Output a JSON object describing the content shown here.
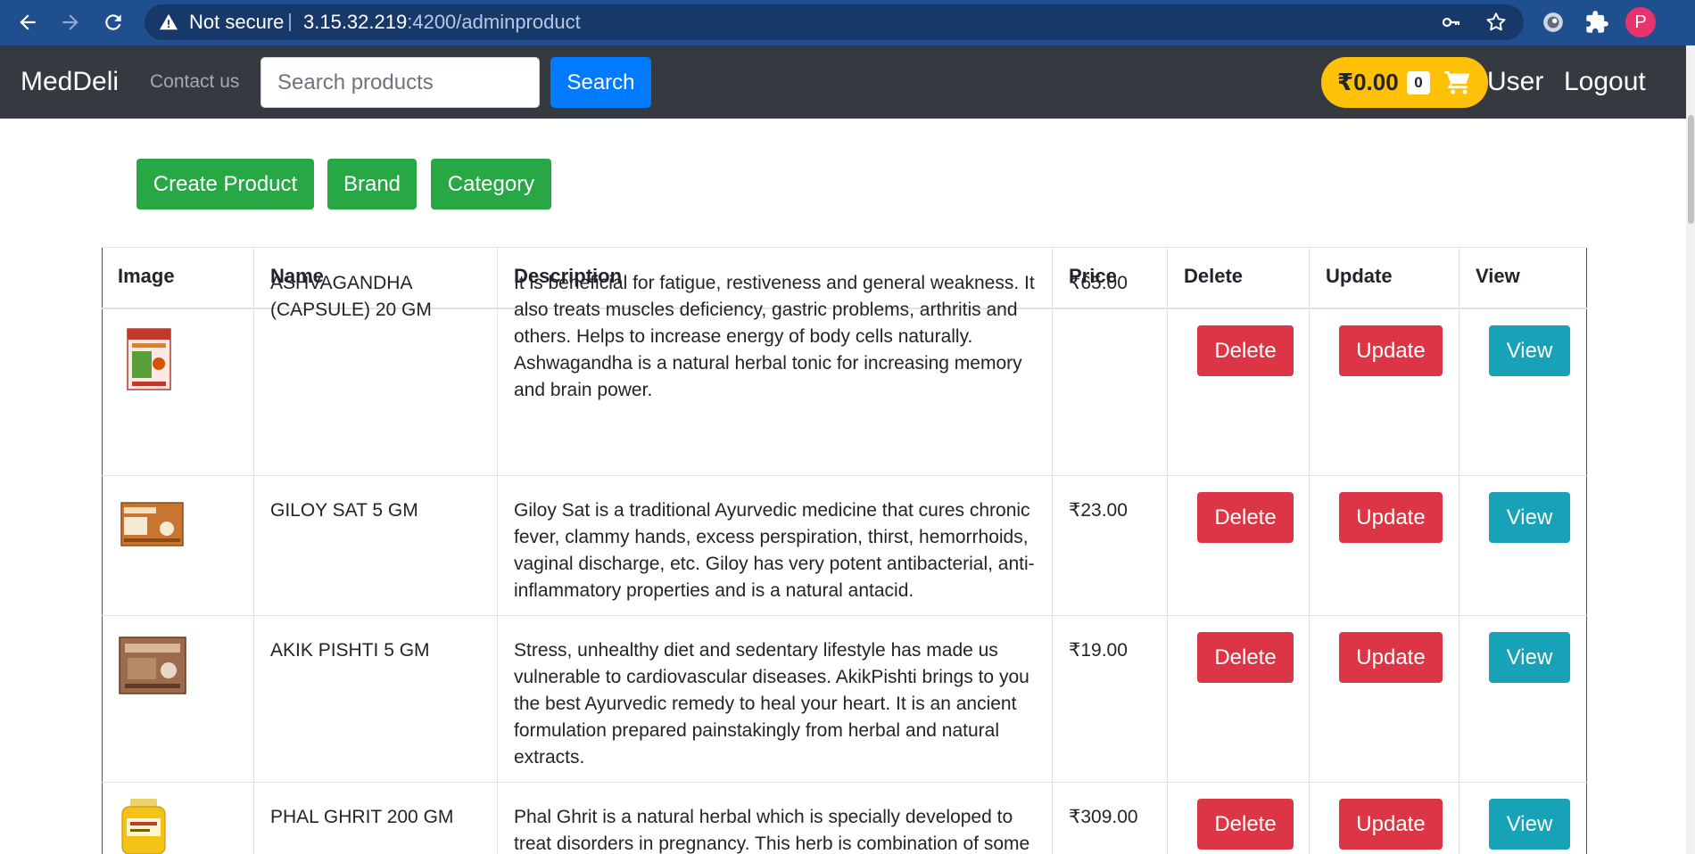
{
  "browser": {
    "security_label": "Not secure",
    "url_host": "3.15.32.219",
    "url_path": ":4200/adminproduct",
    "profile_initial": "P"
  },
  "navbar": {
    "brand": "MedDeli",
    "contact": "Contact us",
    "search_placeholder": "Search products",
    "search_button": "Search",
    "cart_total": "₹0.00",
    "cart_count": "0",
    "user": "User",
    "logout": "Logout"
  },
  "actions": {
    "create_product": "Create Product",
    "brand": "Brand",
    "category": "Category"
  },
  "table": {
    "headers": [
      "Image",
      "Name",
      "Description",
      "Price",
      "Delete",
      "Update",
      "View"
    ],
    "delete_label": "Delete",
    "update_label": "Update",
    "view_label": "View",
    "rows": [
      {
        "name_lines": [
          "ASHVAGANDHA",
          "(CAPSULE) 20 GM"
        ],
        "desc_lines": [
          "It is beneficial for fatigue, restiveness and general weakness. It",
          "also treats muscles deficiency, gastric problems, arthritis and",
          "others. Helps to increase energy of body cells naturally.",
          "Ashwagandha is a natural herbal tonic for increasing memory",
          "and brain power."
        ],
        "price": "₹65.00"
      },
      {
        "name_lines": [
          "GILOY SAT 5 GM"
        ],
        "desc_lines": [
          "Giloy Sat is a traditional Ayurvedic medicine that cures chronic",
          "fever, clammy hands, excess perspiration, thirst, hemorrhoids,",
          "vaginal discharge, etc. Giloy has very potent antibacterial, anti-",
          "inflammatory properties and is a natural antacid."
        ],
        "price": "₹23.00"
      },
      {
        "name_lines": [
          "AKIK PISHTI 5 GM"
        ],
        "desc_lines": [
          "Stress, unhealthy diet and sedentary lifestyle has made us",
          "vulnerable to cardiovascular diseases. AkikPishti brings to you",
          "the best Ayurvedic remedy to heal your heart. It is an ancient",
          "formulation prepared painstakingly from herbal and natural",
          "extracts."
        ],
        "price": "₹19.00"
      },
      {
        "name_lines": [
          "PHAL GHRIT 200 GM"
        ],
        "desc_lines": [
          "Phal Ghrit is a natural herbal which is specially developed to",
          "treat disorders in pregnancy. This herb is combination of some"
        ],
        "price": "₹309.00"
      }
    ]
  },
  "colors": {
    "chrome": "#1f4f8f",
    "navbar": "#343a40",
    "primary": "#007bff",
    "success": "#28a745",
    "danger": "#dc3545",
    "info": "#17a2b8",
    "cart": "#ffc107"
  },
  "icons": [
    "back-arrow-icon",
    "forward-arrow-icon",
    "reload-icon",
    "warning-icon",
    "key-icon",
    "star-icon",
    "extension-ring-icon",
    "puzzle-icon",
    "cart-icon"
  ]
}
